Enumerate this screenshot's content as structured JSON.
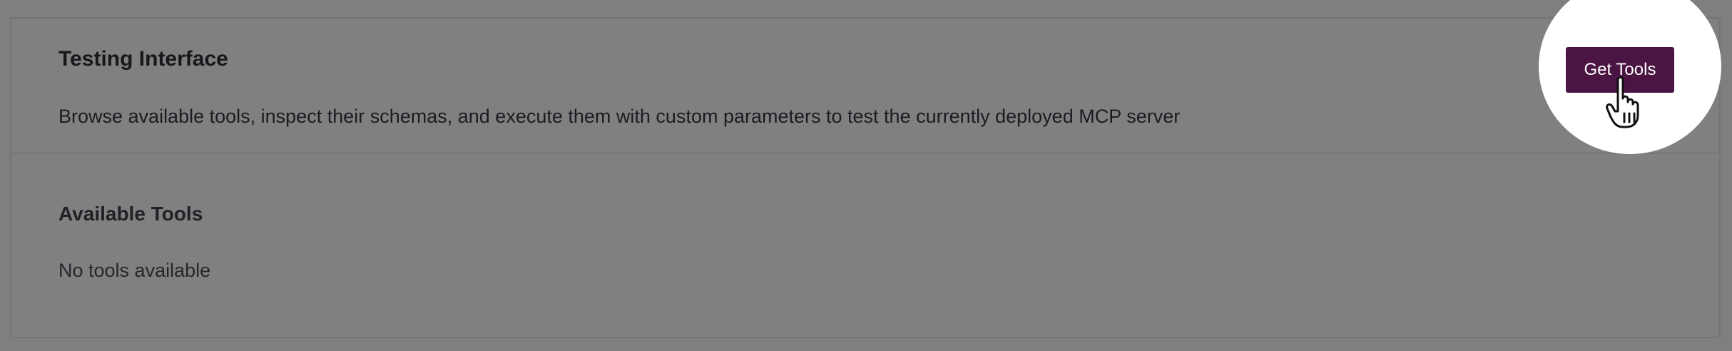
{
  "testing_interface": {
    "title": "Testing Interface",
    "description": "Browse available tools, inspect their schemas, and execute them with custom parameters to test the currently deployed MCP server",
    "get_tools_label": "Get Tools"
  },
  "available_tools": {
    "title": "Available Tools",
    "empty_text": "No tools available"
  },
  "icons": {
    "cursor": "hand-pointer-icon"
  },
  "colors": {
    "overlay": "#7f7f7f",
    "button_bg": "#4a1542",
    "button_text": "#ffffff",
    "spotlight": "#ffffff"
  }
}
